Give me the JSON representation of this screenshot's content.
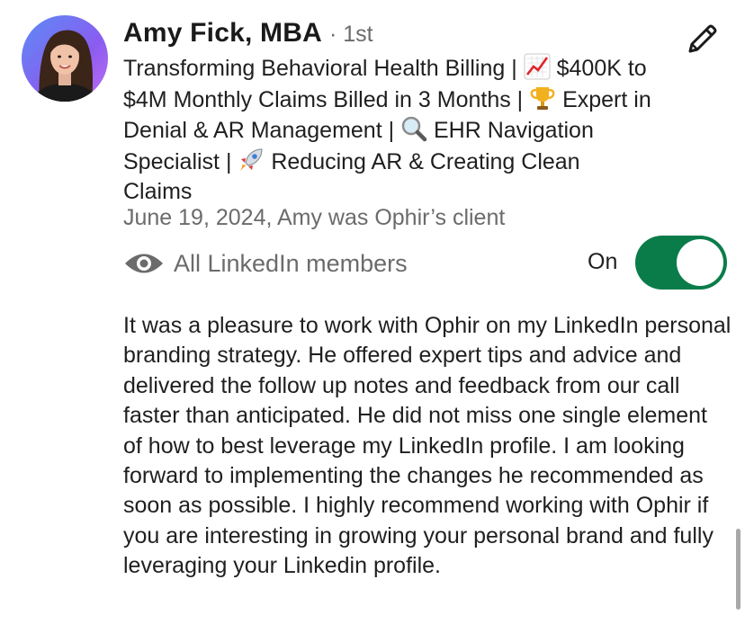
{
  "recommendation": {
    "author_name": "Amy Fick, MBA",
    "degree": "· 1st",
    "headline_parts": [
      "Transforming Behavioral Health Billing | ",
      " $400K to $4M Monthly Claims Billed in 3 Months | ",
      " Expert in Denial & AR Management | ",
      " EHR Navigation Specialist | ",
      " Reducing AR & Creating Clean Claims"
    ],
    "headline_icons": [
      "chart-increasing-emoji",
      "trophy-emoji",
      "magnifying-glass-emoji",
      "rocket-emoji"
    ],
    "date_relation": "June 19, 2024, Amy was Ophir’s client",
    "visibility_label": "All LinkedIn members",
    "toggle_label": "On",
    "toggle_state": true,
    "body": "It was a pleasure to work with Ophir on my LinkedIn personal branding strategy. He offered expert tips and advice and delivered the follow up notes and feedback from our call faster than anticipated. He did not miss one single element of how to best leverage my LinkedIn profile. I am looking forward to implementing the changes he recommended as soon as possible. I highly recommend working with Ophir if you are interesting in growing your personal brand and fully leveraging your Linkedin profile."
  },
  "icons": {
    "edit": "pencil-icon",
    "visibility": "eye-icon"
  },
  "colors": {
    "toggle_on": "#0a7c4a",
    "secondary_text": "#6b6b6b",
    "primary_text": "#1f1f1f",
    "avatar_background": "#7b5cf0"
  }
}
